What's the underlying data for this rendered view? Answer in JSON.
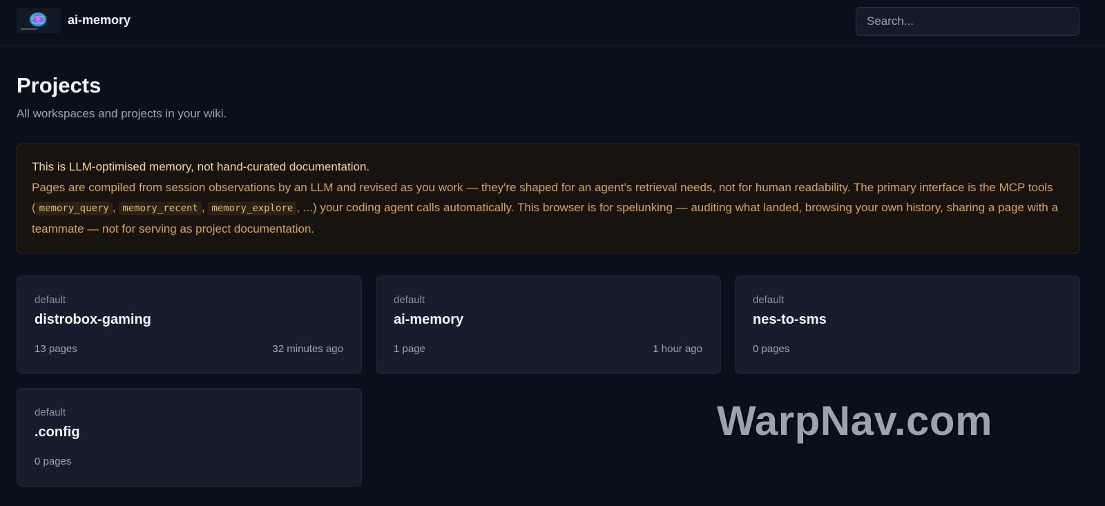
{
  "header": {
    "brand": "ai-memory",
    "search_placeholder": "Search..."
  },
  "page": {
    "title": "Projects",
    "subtitle": "All workspaces and projects in your wiki."
  },
  "notice": {
    "title": "This is LLM-optimised memory, not hand-curated documentation.",
    "text_1": "Pages are compiled from session observations by an LLM and revised as you work — they're shaped for an agent's retrieval needs, not for human readability. The primary interface is the MCP tools (",
    "tool_1": "memory_query",
    "sep_1": ", ",
    "tool_2": "memory_recent",
    "sep_2": ", ",
    "tool_3": "memory_explore",
    "text_2": ", ...) your coding agent calls automatically. This browser is for spelunking — auditing what landed, browsing your own history, sharing a page with a teammate — not for serving as project documentation."
  },
  "projects": [
    {
      "workspace": "default",
      "name": "distrobox-gaming",
      "pages": "13 pages",
      "updated": "32 minutes ago"
    },
    {
      "workspace": "default",
      "name": "ai-memory",
      "pages": "1 page",
      "updated": "1 hour ago"
    },
    {
      "workspace": "default",
      "name": "nes-to-sms",
      "pages": "0 pages",
      "updated": ""
    },
    {
      "workspace": "default",
      "name": ".config",
      "pages": "0 pages",
      "updated": ""
    }
  ],
  "watermark": "WarpNav.com",
  "colors": {
    "background": "#0a0f1c",
    "card": "#161d2d",
    "notice_bg": "#17130f",
    "notice_text": "#d9a54a",
    "notice_title": "#f3d58c"
  }
}
